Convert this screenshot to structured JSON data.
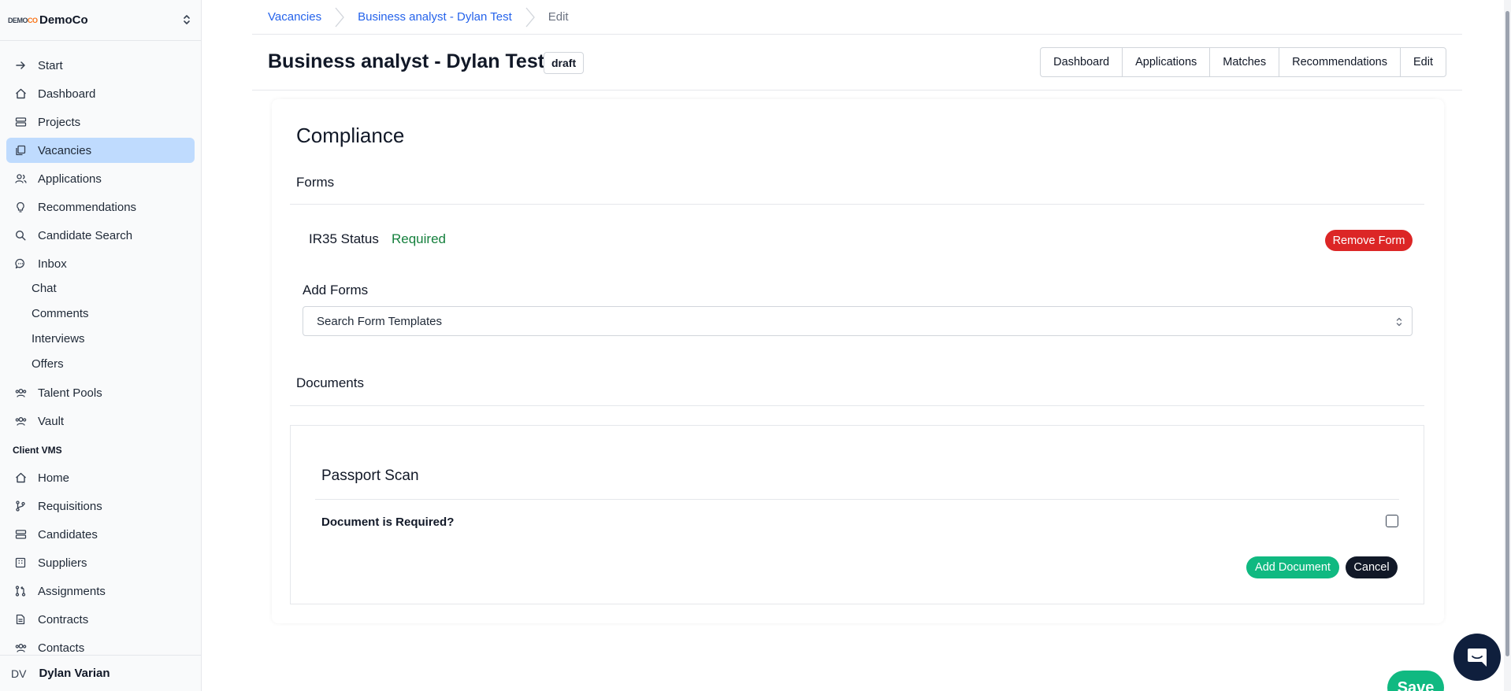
{
  "org": {
    "logo_left": "DEMO",
    "logo_right": "CO",
    "name": "DemoCo"
  },
  "sidebar": {
    "items": [
      {
        "label": "Start",
        "icon": "arrow-right-icon"
      },
      {
        "label": "Dashboard",
        "icon": "home-icon"
      },
      {
        "label": "Projects",
        "icon": "layers-icon"
      },
      {
        "label": "Vacancies",
        "icon": "copy-icon",
        "active": true
      },
      {
        "label": "Applications",
        "icon": "users-icon"
      },
      {
        "label": "Recommendations",
        "icon": "lightbulb-icon"
      },
      {
        "label": "Candidate Search",
        "icon": "search-icon"
      },
      {
        "label": "Inbox",
        "icon": "chat-bubble-icon"
      }
    ],
    "inbox_sub": [
      "Chat",
      "Comments",
      "Interviews",
      "Offers"
    ],
    "items2": [
      {
        "label": "Talent Pools",
        "icon": "team-icon"
      },
      {
        "label": "Vault",
        "icon": "team-icon"
      }
    ],
    "section_label": "Client VMS",
    "vms_items": [
      {
        "label": "Home",
        "icon": "home-icon"
      },
      {
        "label": "Requisitions",
        "icon": "git-branch-icon"
      },
      {
        "label": "Candidates",
        "icon": "layers-icon"
      },
      {
        "label": "Suppliers",
        "icon": "building-icon"
      },
      {
        "label": "Assignments",
        "icon": "git-pull-request-icon"
      },
      {
        "label": "Contracts",
        "icon": "document-icon"
      },
      {
        "label": "Contacts",
        "icon": "team-icon"
      }
    ],
    "user": {
      "initials": "DV",
      "name": "Dylan Varian"
    }
  },
  "breadcrumb": {
    "items": [
      "Vacancies",
      "Business analyst - Dylan Test"
    ],
    "current": "Edit"
  },
  "header": {
    "title": "Business analyst - Dylan Test",
    "status": "draft",
    "tabs": [
      "Dashboard",
      "Applications",
      "Matches",
      "Recommendations",
      "Edit"
    ]
  },
  "compliance": {
    "title": "Compliance",
    "forms_heading": "Forms",
    "form": {
      "name": "IR35 Status",
      "status": "Required",
      "remove_label": "Remove Form"
    },
    "add_forms_label": "Add Forms",
    "select_placeholder": "Search Form Templates",
    "documents_heading": "Documents",
    "document": {
      "title": "Passport Scan",
      "required_label": "Document is Required?",
      "required": false,
      "add_label": "Add Document",
      "cancel_label": "Cancel"
    }
  },
  "save_label": "Save",
  "colors": {
    "accent": "#10b981",
    "danger": "#dc2626",
    "link": "#2563eb",
    "active_nav": "#bfdbfe"
  }
}
